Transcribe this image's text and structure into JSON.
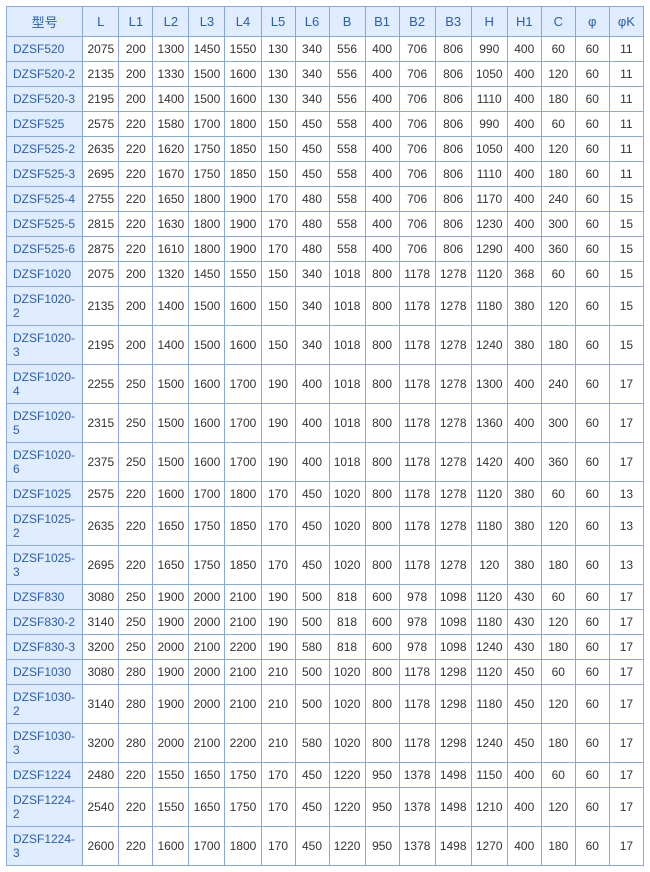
{
  "headers": [
    "型号",
    "L",
    "L1",
    "L2",
    "L3",
    "L4",
    "L5",
    "L6",
    "B",
    "B1",
    "B2",
    "B3",
    "H",
    "H1",
    "C",
    "φ",
    "φK"
  ],
  "rows": [
    [
      "DZSF520",
      "2075",
      "200",
      "1300",
      "1450",
      "1550",
      "130",
      "340",
      "556",
      "400",
      "706",
      "806",
      "990",
      "400",
      "60",
      "60",
      "11"
    ],
    [
      "DZSF520-2",
      "2135",
      "200",
      "1330",
      "1500",
      "1600",
      "130",
      "340",
      "556",
      "400",
      "706",
      "806",
      "1050",
      "400",
      "120",
      "60",
      "11"
    ],
    [
      "DZSF520-3",
      "2195",
      "200",
      "1400",
      "1500",
      "1600",
      "130",
      "340",
      "556",
      "400",
      "706",
      "806",
      "1110",
      "400",
      "180",
      "60",
      "11"
    ],
    [
      "DZSF525",
      "2575",
      "220",
      "1580",
      "1700",
      "1800",
      "150",
      "450",
      "558",
      "400",
      "706",
      "806",
      "990",
      "400",
      "60",
      "60",
      "11"
    ],
    [
      "DZSF525-2",
      "2635",
      "220",
      "1620",
      "1750",
      "1850",
      "150",
      "450",
      "558",
      "400",
      "706",
      "806",
      "1050",
      "400",
      "120",
      "60",
      "11"
    ],
    [
      "DZSF525-3",
      "2695",
      "220",
      "1670",
      "1750",
      "1850",
      "150",
      "450",
      "558",
      "400",
      "706",
      "806",
      "1110",
      "400",
      "180",
      "60",
      "11"
    ],
    [
      "DZSF525-4",
      "2755",
      "220",
      "1650",
      "1800",
      "1900",
      "170",
      "480",
      "558",
      "400",
      "706",
      "806",
      "1170",
      "400",
      "240",
      "60",
      "15"
    ],
    [
      "DZSF525-5",
      "2815",
      "220",
      "1630",
      "1800",
      "1900",
      "170",
      "480",
      "558",
      "400",
      "706",
      "806",
      "1230",
      "400",
      "300",
      "60",
      "15"
    ],
    [
      "DZSF525-6",
      "2875",
      "220",
      "1610",
      "1800",
      "1900",
      "170",
      "480",
      "558",
      "400",
      "706",
      "806",
      "1290",
      "400",
      "360",
      "60",
      "15"
    ],
    [
      "DZSF1020",
      "2075",
      "200",
      "1320",
      "1450",
      "1550",
      "150",
      "340",
      "1018",
      "800",
      "1178",
      "1278",
      "1120",
      "368",
      "60",
      "60",
      "15"
    ],
    [
      "DZSF1020-2",
      "2135",
      "200",
      "1400",
      "1500",
      "1600",
      "150",
      "340",
      "1018",
      "800",
      "1178",
      "1278",
      "1180",
      "380",
      "120",
      "60",
      "15"
    ],
    [
      "DZSF1020-3",
      "2195",
      "200",
      "1400",
      "1500",
      "1600",
      "150",
      "340",
      "1018",
      "800",
      "1178",
      "1278",
      "1240",
      "380",
      "180",
      "60",
      "15"
    ],
    [
      "DZSF1020-4",
      "2255",
      "250",
      "1500",
      "1600",
      "1700",
      "190",
      "400",
      "1018",
      "800",
      "1178",
      "1278",
      "1300",
      "400",
      "240",
      "60",
      "17"
    ],
    [
      "DZSF1020-5",
      "2315",
      "250",
      "1500",
      "1600",
      "1700",
      "190",
      "400",
      "1018",
      "800",
      "1178",
      "1278",
      "1360",
      "400",
      "300",
      "60",
      "17"
    ],
    [
      "DZSF1020-6",
      "2375",
      "250",
      "1500",
      "1600",
      "1700",
      "190",
      "400",
      "1018",
      "800",
      "1178",
      "1278",
      "1420",
      "400",
      "360",
      "60",
      "17"
    ],
    [
      "DZSF1025",
      "2575",
      "220",
      "1600",
      "1700",
      "1800",
      "170",
      "450",
      "1020",
      "800",
      "1178",
      "1278",
      "1120",
      "380",
      "60",
      "60",
      "13"
    ],
    [
      "DZSF1025-2",
      "2635",
      "220",
      "1650",
      "1750",
      "1850",
      "170",
      "450",
      "1020",
      "800",
      "1178",
      "1278",
      "1180",
      "380",
      "120",
      "60",
      "13"
    ],
    [
      "DZSF1025-3",
      "2695",
      "220",
      "1650",
      "1750",
      "1850",
      "170",
      "450",
      "1020",
      "800",
      "1178",
      "1278",
      "120",
      "380",
      "180",
      "60",
      "13"
    ],
    [
      "DZSF830",
      "3080",
      "250",
      "1900",
      "2000",
      "2100",
      "190",
      "500",
      "818",
      "600",
      "978",
      "1098",
      "1120",
      "430",
      "60",
      "60",
      "17"
    ],
    [
      "DZSF830-2",
      "3140",
      "250",
      "1900",
      "2000",
      "2100",
      "190",
      "500",
      "818",
      "600",
      "978",
      "1098",
      "1180",
      "430",
      "120",
      "60",
      "17"
    ],
    [
      "DZSF830-3",
      "3200",
      "250",
      "2000",
      "2100",
      "2200",
      "190",
      "580",
      "818",
      "600",
      "978",
      "1098",
      "1240",
      "430",
      "180",
      "60",
      "17"
    ],
    [
      "DZSF1030",
      "3080",
      "280",
      "1900",
      "2000",
      "2100",
      "210",
      "500",
      "1020",
      "800",
      "1178",
      "1298",
      "1120",
      "450",
      "60",
      "60",
      "17"
    ],
    [
      "DZSF1030-2",
      "3140",
      "280",
      "1900",
      "2000",
      "2100",
      "210",
      "500",
      "1020",
      "800",
      "1178",
      "1298",
      "1180",
      "450",
      "120",
      "60",
      "17"
    ],
    [
      "DZSF1030-3",
      "3200",
      "280",
      "2000",
      "2100",
      "2200",
      "210",
      "580",
      "1020",
      "800",
      "1178",
      "1298",
      "1240",
      "450",
      "180",
      "60",
      "17"
    ],
    [
      "DZSF1224",
      "2480",
      "220",
      "1550",
      "1650",
      "1750",
      "170",
      "450",
      "1220",
      "950",
      "1378",
      "1498",
      "1150",
      "400",
      "60",
      "60",
      "17"
    ],
    [
      "DZSF1224-2",
      "2540",
      "220",
      "1550",
      "1650",
      "1750",
      "170",
      "450",
      "1220",
      "950",
      "1378",
      "1498",
      "1210",
      "400",
      "120",
      "60",
      "17"
    ],
    [
      "DZSF1224-3",
      "2600",
      "220",
      "1600",
      "1700",
      "1800",
      "170",
      "450",
      "1220",
      "950",
      "1378",
      "1498",
      "1270",
      "400",
      "180",
      "60",
      "17"
    ]
  ]
}
